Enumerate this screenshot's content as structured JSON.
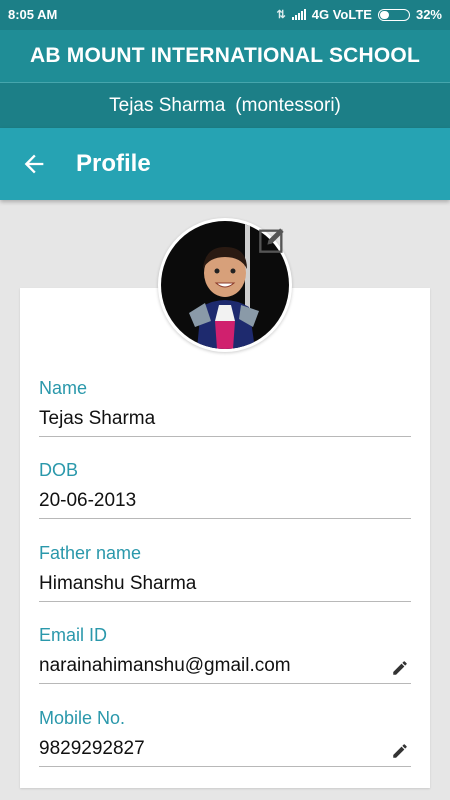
{
  "status_bar": {
    "time": "8:05 AM",
    "network": "4G VoLTE",
    "battery": "32%",
    "battery_level": 0.32
  },
  "header": {
    "school_name": "AB MOUNT INTERNATIONAL SCHOOL",
    "student_name": "Tejas Sharma",
    "student_class": "(montessori)"
  },
  "app_bar": {
    "title": "Profile",
    "back_icon": "arrow-back-icon"
  },
  "profile": {
    "photo_edit_icon": "edit-square-icon",
    "fields": [
      {
        "label": "Name",
        "value": "Tejas Sharma",
        "editable": false
      },
      {
        "label": "DOB",
        "value": "20-06-2013",
        "editable": false
      },
      {
        "label": "Father name",
        "value": "Himanshu Sharma",
        "editable": false
      },
      {
        "label": "Email ID",
        "value": "narainahimanshu@gmail.com",
        "editable": true
      },
      {
        "label": "Mobile No.",
        "value": "9829292827",
        "editable": true
      }
    ]
  },
  "colors": {
    "status_bar": "#1c7f87",
    "school_bar": "#1f8d96",
    "app_bar": "#26a3b3",
    "label": "#2a98ab",
    "background": "#e6e6e6"
  }
}
